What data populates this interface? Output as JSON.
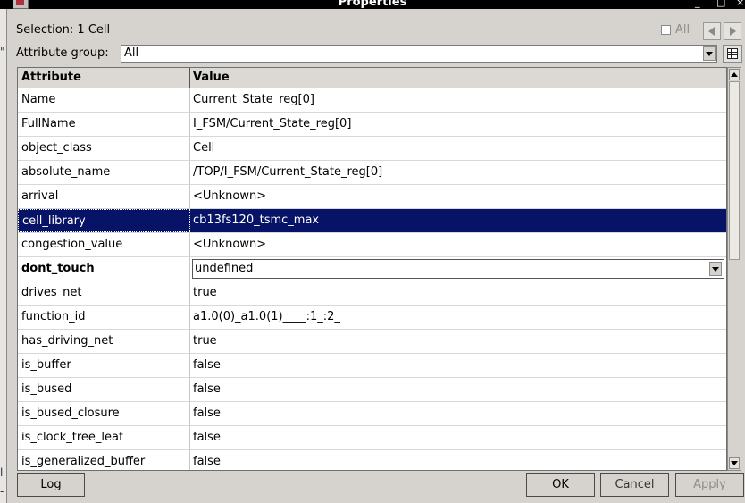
{
  "window": {
    "title": "Properties",
    "minimize": "_",
    "maximize": "□",
    "close": "×"
  },
  "background_fragments": [
    "l",
    "-",
    "\""
  ],
  "selection_label": "Selection: 1 Cell",
  "all_label": "All",
  "attribute_group": {
    "label": "Attribute group:",
    "value": "All"
  },
  "grid": {
    "col_attribute": "Attribute",
    "col_value": "Value",
    "rows": [
      {
        "attr": "Name",
        "value": "Current_State_reg[0]"
      },
      {
        "attr": "FullName",
        "value": "I_FSM/Current_State_reg[0]"
      },
      {
        "attr": "object_class",
        "value": "Cell"
      },
      {
        "attr": "absolute_name",
        "value": "/TOP/I_FSM/Current_State_reg[0]"
      },
      {
        "attr": "arrival",
        "value": "<Unknown>"
      },
      {
        "attr": "cell_library",
        "value": "cb13fs120_tsmc_max"
      },
      {
        "attr": "congestion_value",
        "value": "<Unknown>"
      },
      {
        "attr": "dont_touch",
        "value": "undefined"
      },
      {
        "attr": "drives_net",
        "value": "true"
      },
      {
        "attr": "function_id",
        "value": "a1.0(0)_a1.0(1)____:1_:2_"
      },
      {
        "attr": "has_driving_net",
        "value": "true"
      },
      {
        "attr": "is_buffer",
        "value": "false"
      },
      {
        "attr": "is_bused",
        "value": "false"
      },
      {
        "attr": "is_bused_closure",
        "value": "false"
      },
      {
        "attr": "is_clock_tree_leaf",
        "value": "false"
      },
      {
        "attr": "is_generalized_buffer",
        "value": "false"
      }
    ]
  },
  "buttons": {
    "log": "Log",
    "ok": "OK",
    "cancel": "Cancel",
    "apply": "Apply"
  },
  "colors": {
    "selection": "#061366",
    "dialog_bg": "#d6d3ce"
  }
}
